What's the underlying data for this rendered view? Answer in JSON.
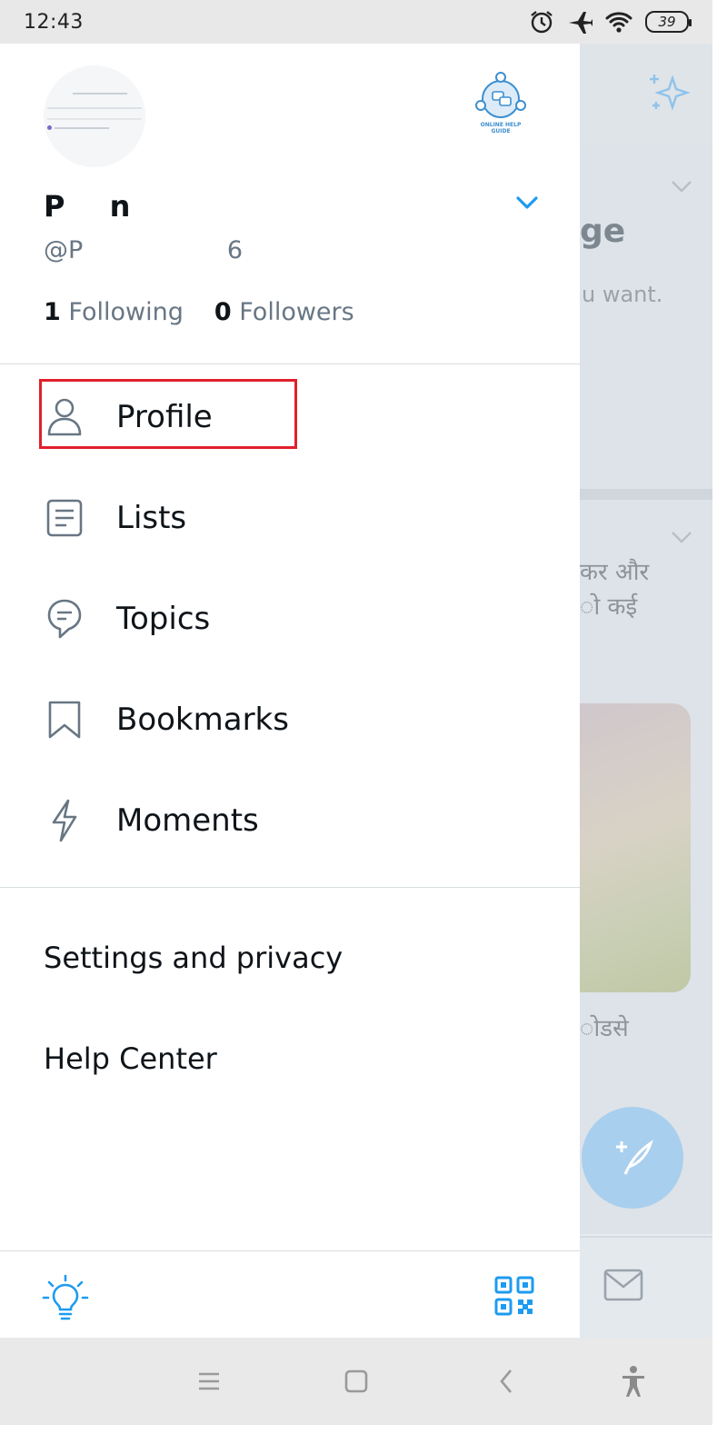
{
  "status_bar": {
    "time": "12:43",
    "battery": "39",
    "icons": [
      "alarm-icon",
      "airplane-icon",
      "wifi-icon",
      "battery-icon"
    ]
  },
  "drawer": {
    "display_name": "P n",
    "handle": "@P 6",
    "following_count": "1",
    "following_label": "Following",
    "followers_count": "0",
    "followers_label": "Followers",
    "account_logo_text": "ONLINE HELP GUIDE",
    "menu": [
      {
        "label": "Profile",
        "icon": "person-icon"
      },
      {
        "label": "Lists",
        "icon": "list-icon"
      },
      {
        "label": "Topics",
        "icon": "topic-bubble-icon"
      },
      {
        "label": "Bookmarks",
        "icon": "bookmark-icon"
      },
      {
        "label": "Moments",
        "icon": "lightning-icon"
      }
    ],
    "settings_label": "Settings and privacy",
    "help_label": "Help Center",
    "footer_icons": [
      "lightbulb-icon",
      "qr-code-icon"
    ]
  },
  "background_app": {
    "heading_fragment": "ge",
    "sub_fragment": "u want.",
    "hindi_line1": "कर और",
    "hindi_line2": "ो कई",
    "hindi_line3": "ोडसे"
  },
  "colors": {
    "accent": "#1d9bf0",
    "highlight": "#e0202a",
    "secondary_text": "#687684"
  }
}
